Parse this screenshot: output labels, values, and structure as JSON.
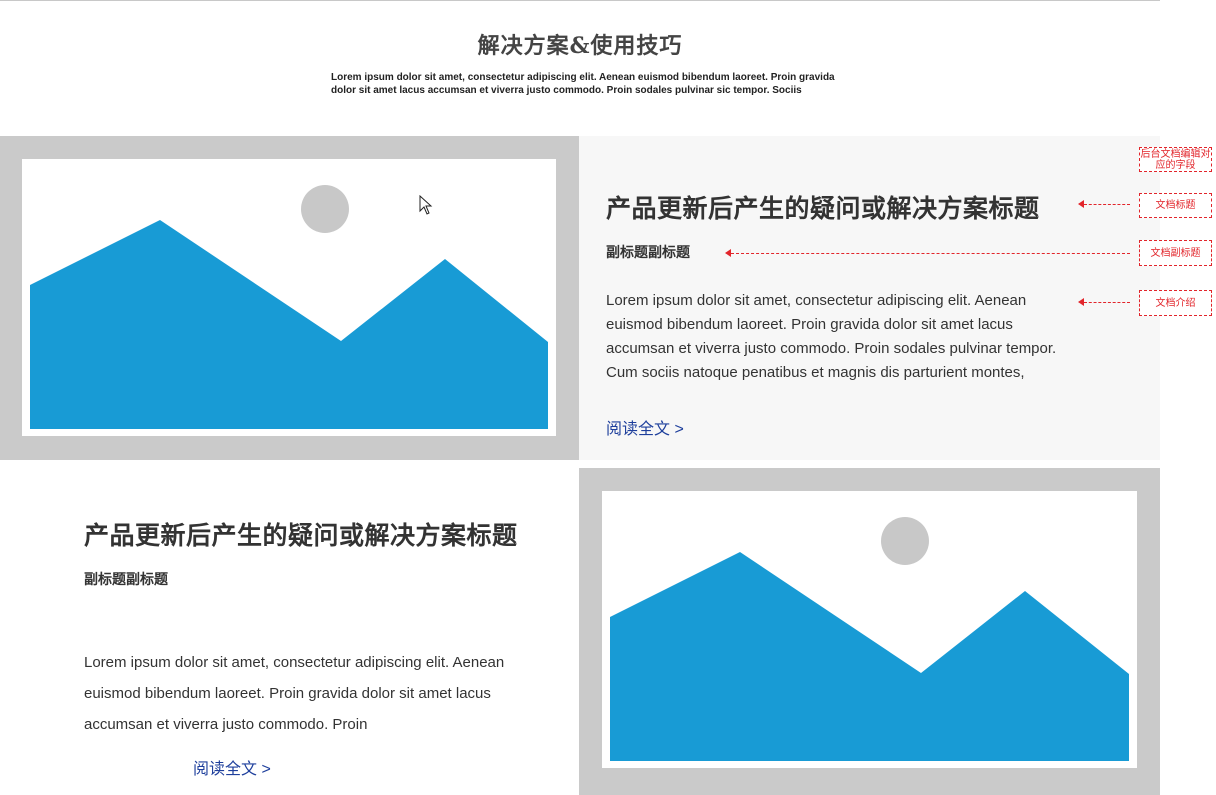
{
  "header": {
    "title": "解决方案&使用技巧",
    "intro": "Lorem ipsum dolor sit amet, consectetur adipiscing elit. Aenean euismod bibendum laoreet. Proin gravida dolor sit amet lacus accumsan et viverra justo commodo. Proin sodales pulvinar sic tempor. Sociis"
  },
  "articles": [
    {
      "title": "产品更新后产生的疑问或解决方案标题",
      "subtitle": "副标题副标题",
      "body": "Lorem ipsum dolor sit amet, consectetur adipiscing elit. Aenean euismod bibendum laoreet. Proin gravida dolor sit amet lacus accumsan et viverra justo commodo. Proin sodales pulvinar tempor. Cum sociis natoque penatibus et magnis dis parturient montes,",
      "read_more": "阅读全文 >"
    },
    {
      "title": "产品更新后产生的疑问或解决方案标题",
      "subtitle": "副标题副标题",
      "body": "Lorem ipsum dolor sit amet, consectetur adipiscing elit. Aenean euismod bibendum laoreet. Proin gravida dolor sit amet lacus accumsan et viverra justo commodo. Proin",
      "read_more": "阅读全文 >"
    }
  ],
  "annotations": {
    "backend_fields": "后台文档编辑对应的字段",
    "doc_title": "文档标题",
    "doc_subtitle": "文档副标题",
    "doc_intro": "文档介绍"
  },
  "colors": {
    "image_placeholder_bg": "#cacaca",
    "mountain": "#189bd5",
    "sun": "#c8c8c8",
    "link": "#1e3f9c",
    "annotation": "#e2252b",
    "panel_bg": "#f7f7f7"
  },
  "icons": {
    "image_placeholder": "image-placeholder-icon",
    "cursor": "mouse-cursor-icon"
  }
}
